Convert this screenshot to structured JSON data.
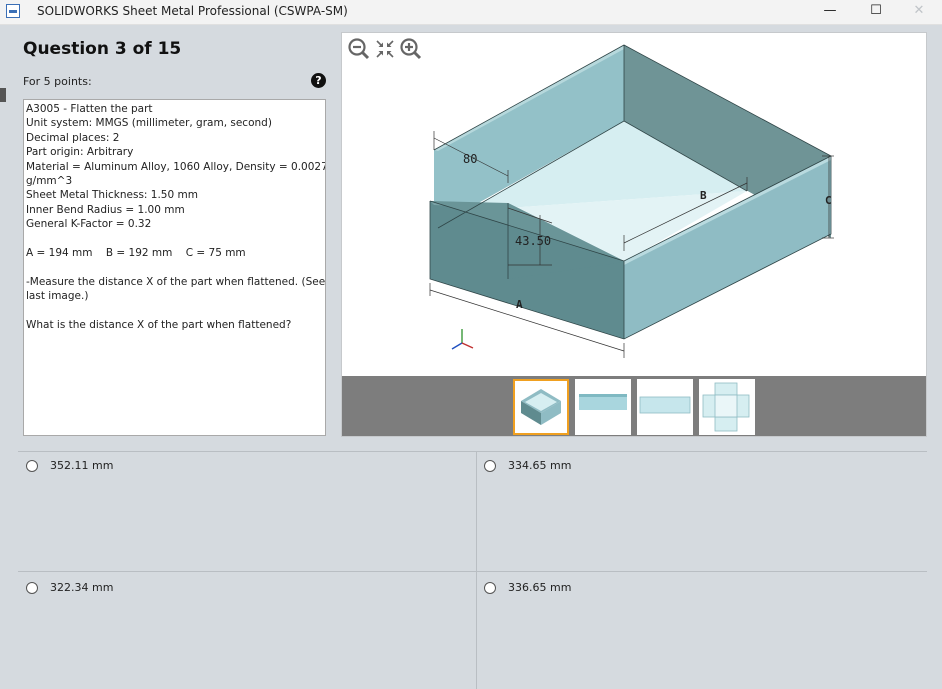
{
  "window": {
    "title": "SOLIDWORKS Sheet Metal Professional (CSWPA-SM)",
    "min_glyph": "—",
    "max_glyph": "☐",
    "close_glyph": "✕"
  },
  "question": {
    "title": "Question 3 of 15",
    "points": "For 5 points:",
    "help_glyph": "?",
    "lines": [
      "A3005 - Flatten the part",
      "Unit system: MMGS (millimeter, gram, second)",
      "Decimal places: 2",
      "Part origin: Arbitrary",
      "Material = Aluminum Alloy, 1060 Alloy, Density = 0.0027",
      "g/mm^3",
      "Sheet Metal Thickness: 1.50 mm",
      "Inner Bend Radius = 1.00 mm",
      "General K-Factor = 0.32",
      "",
      "A = 194 mm    B = 192 mm    C = 75 mm",
      "",
      "-Measure the distance X of the part when flattened. (See",
      "last image.)",
      "",
      "What is the distance X of the part when flattened?"
    ]
  },
  "image": {
    "labels": {
      "dim80": "80",
      "dim4350": "43.50",
      "dimA": "A",
      "dimB": "B",
      "dimC": "C"
    },
    "thumbnails_selected": 0,
    "colors": {
      "box_side": "#8fbcc4",
      "box_dark": "#5f8b8f",
      "box_floor": "#d8eff2",
      "thumb_border": "#f0a020"
    }
  },
  "answers": [
    {
      "label": "352.11 mm",
      "selected": false
    },
    {
      "label": "334.65 mm",
      "selected": false
    },
    {
      "label": "322.34 mm",
      "selected": false
    },
    {
      "label": "336.65 mm",
      "selected": false
    }
  ]
}
